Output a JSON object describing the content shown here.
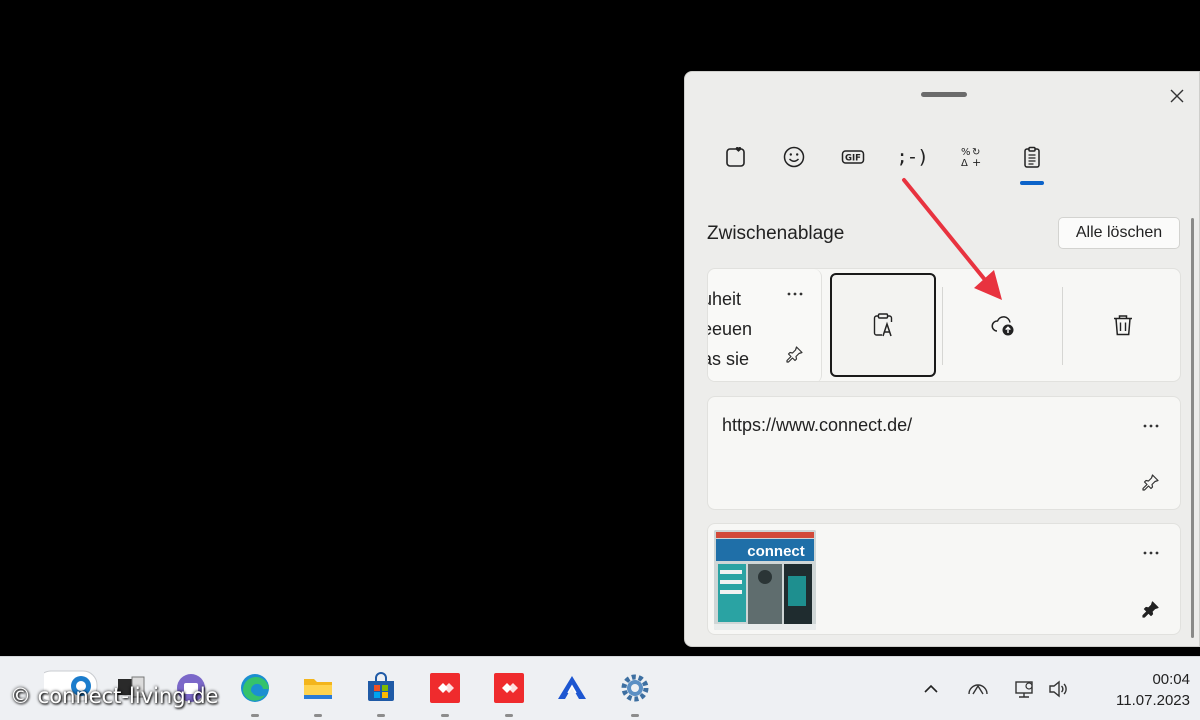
{
  "panel": {
    "tabs": [
      {
        "name": "favorites-tab",
        "icon": "heart-square-icon"
      },
      {
        "name": "emoji-tab",
        "icon": "smiley-icon"
      },
      {
        "name": "gif-tab",
        "icon": "gif-icon",
        "label": "GIF"
      },
      {
        "name": "kaomoji-tab",
        "icon": "kaomoji-icon",
        "label": ";-)"
      },
      {
        "name": "symbols-tab",
        "icon": "symbols-icon"
      },
      {
        "name": "clipboard-tab",
        "icon": "clipboard-icon",
        "active": true
      }
    ],
    "section_title": "Zwischenablage",
    "clear_all_label": "Alle löschen",
    "items": [
      {
        "preview_lines": [
          "uheit",
          "eeuen",
          "as sie"
        ],
        "actions": [
          {
            "name": "paste-as-text",
            "icon": "clipboard-text-icon",
            "selected": true
          },
          {
            "name": "sync",
            "icon": "cloud-upload-icon"
          },
          {
            "name": "delete",
            "icon": "trash-icon"
          }
        ]
      },
      {
        "text": "https://www.connect.de/",
        "pinned": false
      },
      {
        "type": "image",
        "thumbnail_text": "connect",
        "pinned": true
      }
    ]
  },
  "taskbar": {
    "clock": {
      "time": "00:04",
      "date": "11.07.2023"
    }
  },
  "watermark": "© connect-living.de",
  "colors": {
    "accent": "#0c63c9",
    "annotation_arrow": "#e8333f"
  }
}
